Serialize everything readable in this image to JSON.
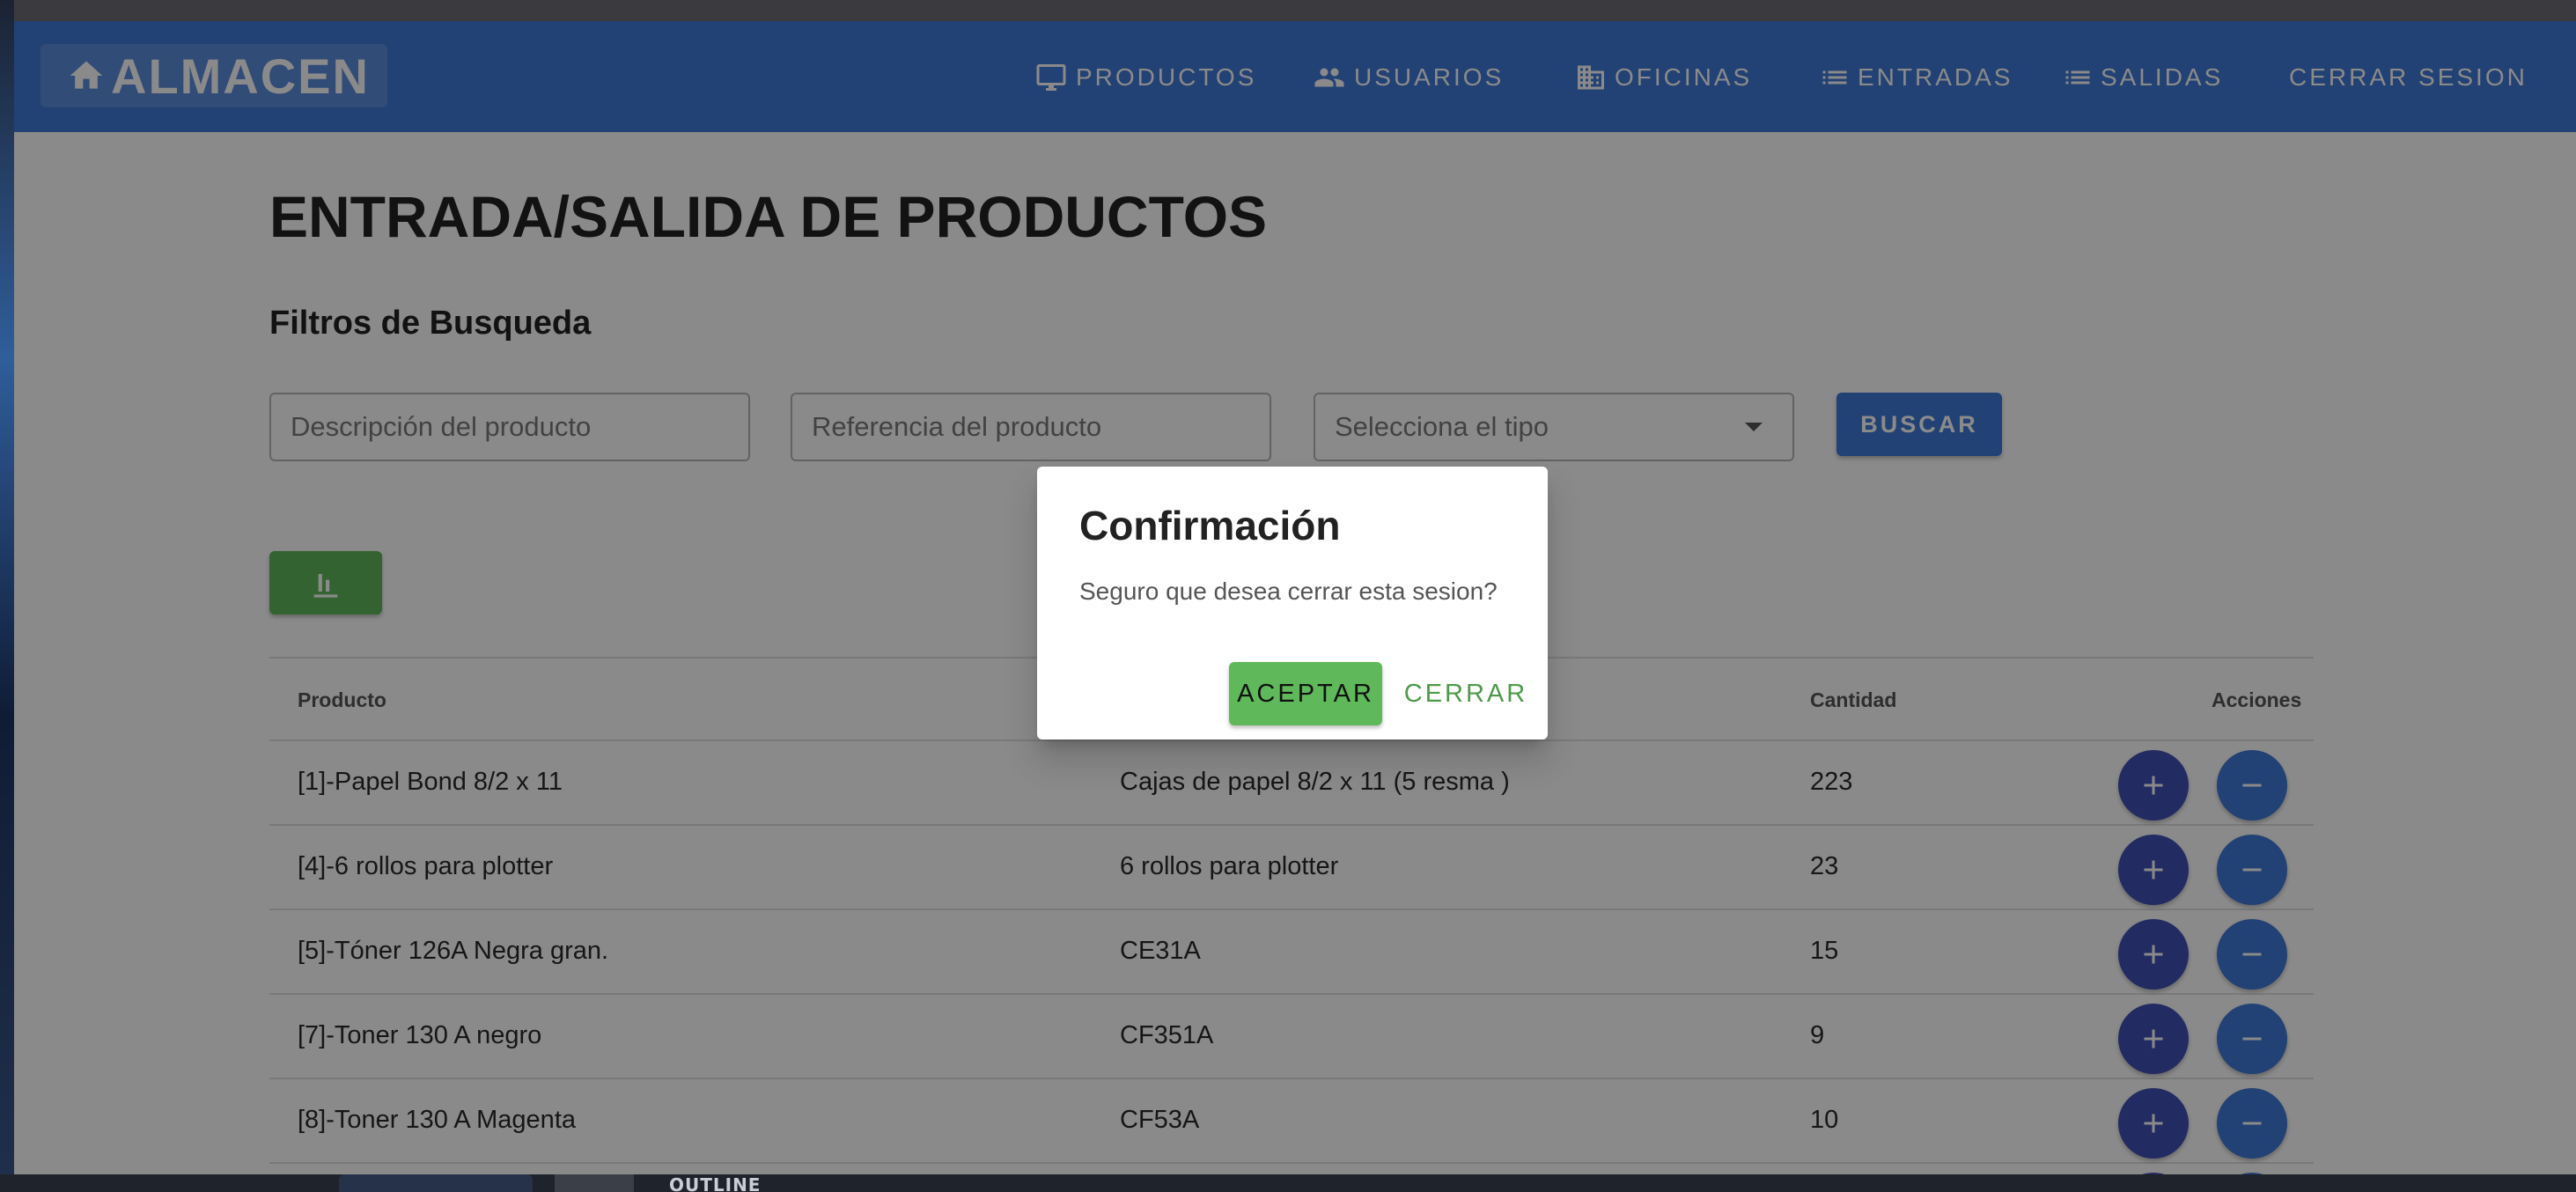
{
  "navbar": {
    "brand": "ALMACEN",
    "items": [
      {
        "label": "PRODUCTOS",
        "icon": "monitor-icon"
      },
      {
        "label": "USUARIOS",
        "icon": "users-icon"
      },
      {
        "label": "OFICINAS",
        "icon": "building-icon"
      },
      {
        "label": "ENTRADAS",
        "icon": "list-icon"
      },
      {
        "label": "SALIDAS",
        "icon": "list-icon"
      },
      {
        "label": "CERRAR SESION"
      }
    ]
  },
  "page": {
    "title": "ENTRADA/SALIDA DE PRODUCTOS",
    "filters_title": "Filtros de Busqueda"
  },
  "filters": {
    "description_placeholder": "Descripción del producto",
    "reference_placeholder": "Referencia del producto",
    "type_placeholder": "Selecciona el tipo",
    "search_label": "BUSCAR"
  },
  "table": {
    "headers": {
      "product": "Producto",
      "quantity": "Cantidad",
      "actions": "Acciones"
    },
    "rows": [
      {
        "product": "[1]-Papel Bond 8/2 x 11",
        "reference": "Cajas de papel 8/2 x 11 (5 resma )",
        "quantity": "223"
      },
      {
        "product": "[4]-6 rollos para plotter",
        "reference": "6 rollos para plotter",
        "quantity": "23"
      },
      {
        "product": "[5]-Tóner 126A Negra gran.",
        "reference": "CE31A",
        "quantity": "15"
      },
      {
        "product": "[7]-Toner 130 A negro",
        "reference": "CF351A",
        "quantity": "9"
      },
      {
        "product": "[8]-Toner 130 A Magenta",
        "reference": "CF53A",
        "quantity": "10"
      }
    ]
  },
  "dialog": {
    "title": "Confirmación",
    "text": "Seguro que desea cerrar esta sesion?",
    "accept_label": "ACEPTAR",
    "close_label": "CERRAR"
  },
  "desktop": {
    "outline_label": "OUTLINE"
  },
  "colors": {
    "primary": "#3f78d6",
    "indigo": "#3f51b5",
    "success": "#5fb85a"
  }
}
